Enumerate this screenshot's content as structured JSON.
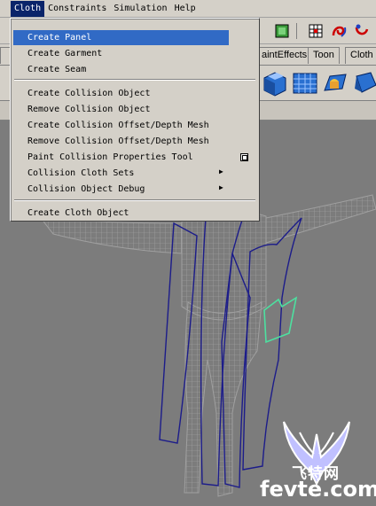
{
  "menubar": {
    "items": [
      "Cloth",
      "Constraints",
      "Simulation",
      "Help"
    ]
  },
  "shelf": {
    "tabs": [
      "aintEffects",
      "Toon",
      "Cloth"
    ]
  },
  "cloth_menu": {
    "items": [
      {
        "label": "Create Panel"
      },
      {
        "label": "Create Garment"
      },
      {
        "label": "Create Seam"
      },
      {
        "label": "Create Collision Object"
      },
      {
        "label": "Remove Collision Object"
      },
      {
        "label": "Create Collision Offset/Depth Mesh"
      },
      {
        "label": "Remove Collision Offset/Depth Mesh"
      },
      {
        "label": "Paint Collision Properties Tool"
      },
      {
        "label": "Collision Cloth Sets"
      },
      {
        "label": "Collision Object Debug"
      },
      {
        "label": "Create Cloth Object"
      }
    ]
  },
  "viewport": {
    "wireframe_color": "#a8a8a8",
    "panel_line_color": "#1c1c8a",
    "highlight_color": "#4de0a0"
  },
  "watermark": {
    "cn": "飞特网",
    "domain": "fevte.com"
  }
}
